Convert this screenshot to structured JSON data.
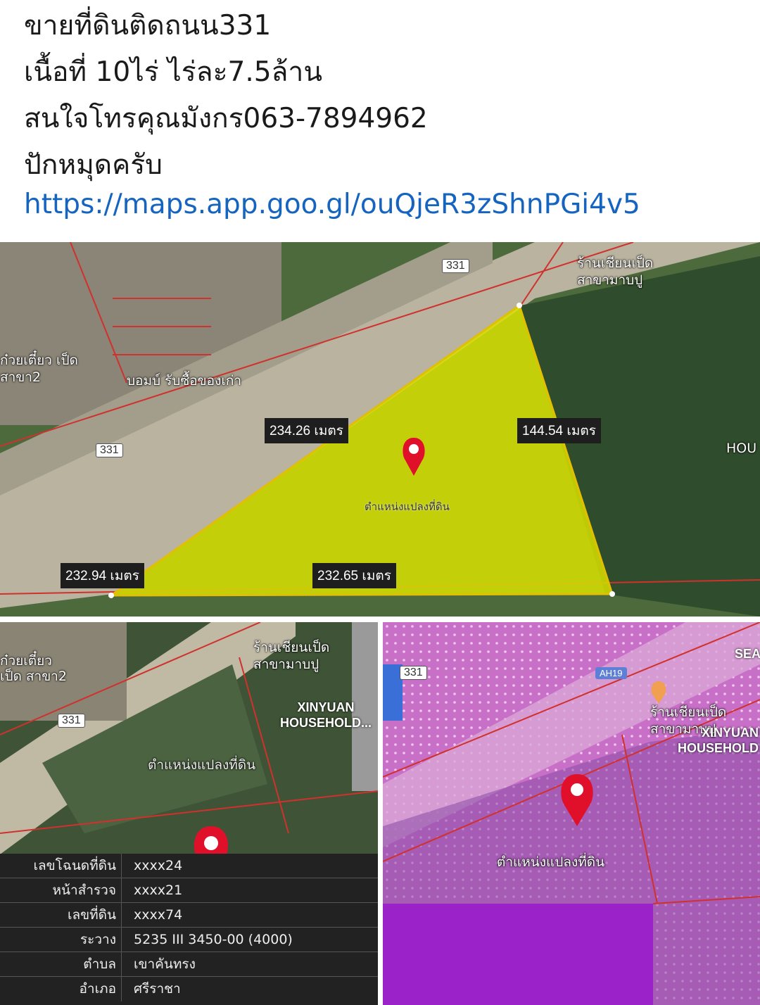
{
  "post": {
    "line1": "ขายที่ดินติดถนน331",
    "line2": "เนื้อที่ 10ไร่ ไร่ละ7.5ล้าน",
    "line3": "สนใจโทรคุณมังกร063-7894962",
    "line4": "ปักหมุดครับ",
    "link": "https://maps.app.goo.gl/ouQjeR3zShnPGi4v5"
  },
  "main_map": {
    "road_sign_top": "331",
    "road_sign_left": "331",
    "shop_label_right": "ร้านเชียนเป็ด สาขามาบปู",
    "shop_label_left": "ก๋วยเตี๋ยว เป็ด สาขา2",
    "shop_label_bomb": "บอมบ์ รับซื้อของเก่า",
    "edge_label_right": "HOU",
    "measure_top": "234.26 เมตร",
    "measure_right": "144.54 เมตร",
    "measure_bottom_left": "232.94 เมตร",
    "measure_bottom": "232.65 เมตร",
    "pin_label": "ตำแหน่งแปลงที่ดิน",
    "plot_color": "#d8e000",
    "pin_color": "#e0102a"
  },
  "left_map": {
    "road_sign": "331",
    "shop_label": "ร้านเชียนเป็ด สาขามาบปู",
    "shop_label_left": "ก๋วยเตี๋ยว เป็ด สาขา2",
    "household_label": "XINYUAN HOUSEHOLD...",
    "pin_label": "ตำแหน่งแปลงที่ดิน"
  },
  "deed": {
    "rows": [
      {
        "key": "เลขโฉนดที่ดิน",
        "value": "xxxx24"
      },
      {
        "key": "หน้าสำรวจ",
        "value": "xxxx21"
      },
      {
        "key": "เลขที่ดิน",
        "value": "xxxx74"
      },
      {
        "key": "ระวาง",
        "value": "5235 III 3450-00 (4000)"
      },
      {
        "key": "ตำบล",
        "value": "เขาคันทรง"
      },
      {
        "key": "อำเภอ",
        "value": "ศรีราชา"
      }
    ]
  },
  "right_map": {
    "road_sign": "331",
    "highway_sign": "AH19",
    "shop_label": "ร้านเชียนเป็ด สาขามาบปู",
    "household_label": "XINYUAN HOUSEHOLD",
    "edge_label": "SEA",
    "pin_label": "ตำแหน่งแปลงที่ดิน",
    "zone_color": "#e06ad8"
  }
}
